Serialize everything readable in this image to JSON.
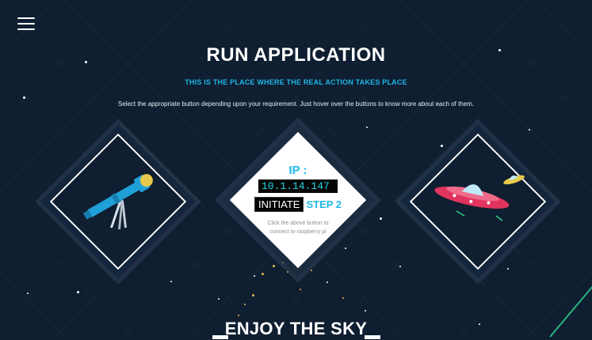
{
  "header": {
    "menu_icon": "hamburger-menu-icon",
    "title": "RUN APPLICATION",
    "subtitle": "THIS IS THE PLACE WHERE THE REAL ACTION TAKES PLACE",
    "description": "Select the appropriate button depending upon your requirement. Just hover over the buttons to know more about each of them."
  },
  "cards": {
    "left": {
      "icon": "telescope-icon"
    },
    "center": {
      "ip_label": "IP :",
      "ip_value": "10.1.14.147",
      "initiate_label": "INITIATE",
      "step_label": "STEP 2",
      "hint": "Click the above button to connect to raspberry pi"
    },
    "right": {
      "icon": "ufo-icon"
    }
  },
  "footer": {
    "title": "ENJOY THE SKY"
  },
  "colors": {
    "background": "#0f1e30",
    "accent": "#1fb6e6"
  }
}
